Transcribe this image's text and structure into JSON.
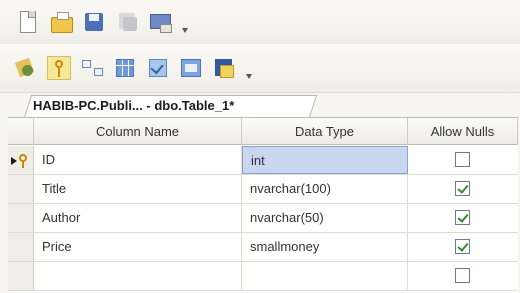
{
  "toolbar1": {
    "icons": [
      "new-file-icon",
      "open-folder-icon",
      "save-icon",
      "save-all-icon",
      "new-query-icon"
    ]
  },
  "toolbar2": {
    "icons": [
      "relationships-icon",
      "set-primary-key-icon",
      "manage-relationships-icon",
      "manage-indexes-icon",
      "manage-check-constraints-icon",
      "manage-spatial-indexes-icon",
      "generate-change-script-icon"
    ]
  },
  "tab": {
    "label": "HABIB-PC.Publi... - dbo.Table_1*"
  },
  "grid": {
    "headers": {
      "column_name": "Column Name",
      "data_type": "Data Type",
      "allow_nulls": "Allow Nulls"
    },
    "rows": [
      {
        "name": "ID",
        "type": "int",
        "allow_nulls": false,
        "primary_key": true,
        "selected": true
      },
      {
        "name": "Title",
        "type": "nvarchar(100)",
        "allow_nulls": true
      },
      {
        "name": "Author",
        "type": "nvarchar(50)",
        "allow_nulls": true
      },
      {
        "name": "Price",
        "type": "smallmoney",
        "allow_nulls": true
      },
      {
        "name": "",
        "type": "",
        "allow_nulls": false
      }
    ]
  },
  "colors": {
    "selection": "#c8d6f0",
    "check": "#2e8a2e",
    "key": "#c98a00"
  }
}
